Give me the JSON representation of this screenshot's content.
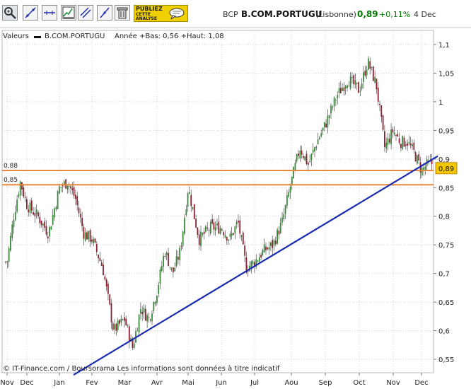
{
  "toolbar": {
    "tools": [
      {
        "icon": "zoom-icon",
        "active": true
      },
      {
        "icon": "trend-line-icon"
      },
      {
        "icon": "horizontal-line-icon"
      },
      {
        "icon": "indicator-chart-icon"
      },
      {
        "icon": "parallel-lines-icon"
      },
      {
        "icon": "diagonal-line-icon"
      },
      {
        "icon": "trash-icon"
      }
    ],
    "publish": {
      "line1": "PUBLIEZ",
      "line2": "CETTE",
      "line3": "ANALYSE"
    }
  },
  "quote": {
    "symbol": "BCP",
    "name": "B.COM.PORTUGU",
    "exchange": "(Lisbonne)",
    "price": "0,89",
    "change": "+0,11%",
    "date": "4 Dec",
    "up_color": "#007a00"
  },
  "info": {
    "label": "Valeurs",
    "series": "B.COM.PORTUGU",
    "stats": "Année +Bas: 0,56 +Haut: 1,08"
  },
  "copyright": "© IT-Finance.com / Boursorama Les informations sont données à titre indicatif",
  "chart_data": {
    "type": "candlestick",
    "x_labels": [
      "Nov",
      "Dec",
      "Jan",
      "Fev",
      "Mar",
      "Avr",
      "Mai",
      "Jun",
      "Jul",
      "Aou",
      "Sep",
      "Oct",
      "Nov",
      "Dec"
    ],
    "y_ticks": [
      "1,1",
      "1,05",
      "1",
      "0,95",
      "0,9",
      "0,85",
      "0,8",
      "0,75",
      "0,7",
      "0,65",
      "0,6",
      "0,55"
    ],
    "ylim": [
      0.54,
      1.11
    ],
    "grid": true,
    "axis_side": "right",
    "price_path": [
      [
        "Nov",
        0.72
      ],
      [
        "Nov",
        0.8
      ],
      [
        "Nov",
        0.86
      ],
      [
        "Dec",
        0.82
      ],
      [
        "Dec",
        0.8
      ],
      [
        "Dec",
        0.77
      ],
      [
        "Jan",
        0.85
      ],
      [
        "Jan",
        0.86
      ],
      [
        "Jan",
        0.83
      ],
      [
        "Jan",
        0.77
      ],
      [
        "Fev",
        0.76
      ],
      [
        "Fev",
        0.71
      ],
      [
        "Fev",
        0.6
      ],
      [
        "Mar",
        0.62
      ],
      [
        "Mar",
        0.57
      ],
      [
        "Mar",
        0.64
      ],
      [
        "Mar",
        0.62
      ],
      [
        "Avr",
        0.67
      ],
      [
        "Avr",
        0.74
      ],
      [
        "Avr",
        0.7
      ],
      [
        "Avr",
        0.74
      ],
      [
        "Mai",
        0.85
      ],
      [
        "Mai",
        0.76
      ],
      [
        "Mai",
        0.78
      ],
      [
        "Jun",
        0.78
      ],
      [
        "Jun",
        0.76
      ],
      [
        "Jun",
        0.79
      ],
      [
        "Jun",
        0.71
      ],
      [
        "Jul",
        0.72
      ],
      [
        "Jul",
        0.74
      ],
      [
        "Jul",
        0.75
      ],
      [
        "Jul",
        0.79
      ],
      [
        "Aou",
        0.86
      ],
      [
        "Aou",
        0.92
      ],
      [
        "Aou",
        0.89
      ],
      [
        "Aou",
        0.93
      ],
      [
        "Sep",
        0.96
      ],
      [
        "Sep",
        1.01
      ],
      [
        "Sep",
        1.04
      ],
      [
        "Oct",
        1.02
      ],
      [
        "Oct",
        1.07
      ],
      [
        "Oct",
        1.03
      ],
      [
        "Oct",
        0.92
      ],
      [
        "Nov",
        0.95
      ],
      [
        "Nov",
        0.93
      ],
      [
        "Nov",
        0.93
      ],
      [
        "Nov",
        0.91
      ],
      [
        "Dec",
        0.88
      ],
      [
        "Dec",
        0.89
      ]
    ],
    "horizontal_lines": [
      {
        "label": "0,88",
        "value": 0.88,
        "color": "#e8883a"
      },
      {
        "label": "0,85",
        "value": 0.855,
        "color": "#e8883a"
      }
    ],
    "trend_line": {
      "from": [
        "Fev",
        0.545
      ],
      "to": [
        "Dec",
        0.91
      ],
      "color": "#1a2bb0"
    },
    "last_price_label": "0,89",
    "up_color": "#3a8a3a",
    "down_color": "#8b2230"
  }
}
